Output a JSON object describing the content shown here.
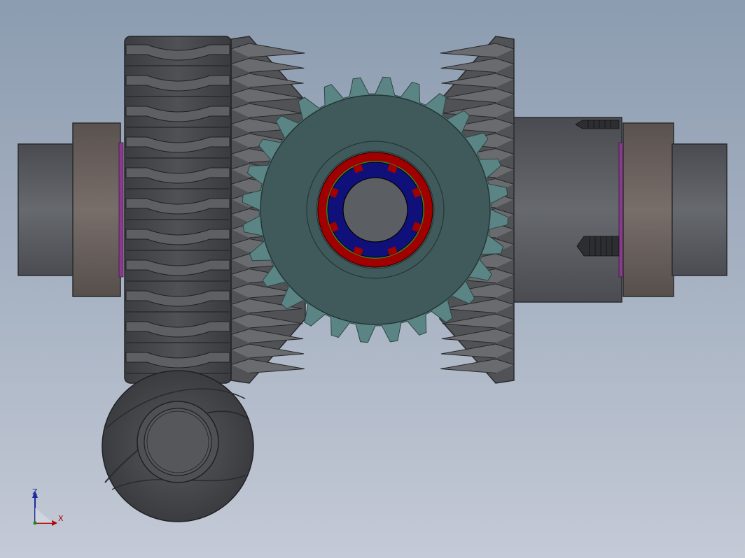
{
  "viewport": {
    "background_top": "#8c9cb0",
    "background_bottom": "#c4cad6"
  },
  "model": {
    "parts": [
      "left-shaft",
      "left-bearing",
      "worm-wheel",
      "left-bevel-gear",
      "spur-gear",
      "right-bevel-gear",
      "right-shaft",
      "right-bearing",
      "worm"
    ],
    "colors": {
      "shaft": "#5b5e63",
      "bearing": "#6b625f",
      "gear_dark": "#4b4c4f",
      "spur_gear": "#40595a",
      "spur_teeth": "#5b8584",
      "ring_red": "#a00000",
      "ring_blue": "#10107a",
      "ring_green": "#2c8a2c",
      "seal_purple": "#8a3a8c"
    }
  },
  "triad": {
    "z_label": "Z",
    "x_label": "X",
    "z_color": "#1a2aa0",
    "x_color": "#b00000"
  }
}
